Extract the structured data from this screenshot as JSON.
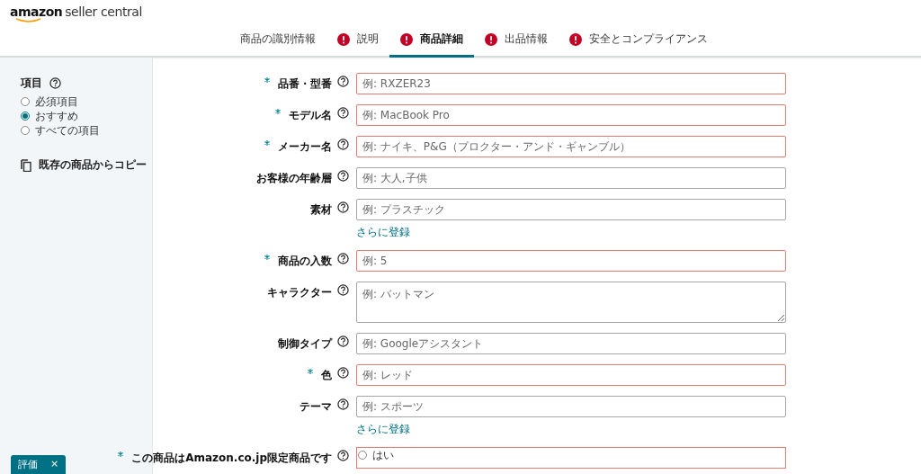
{
  "header": {
    "logo_word": "amazon",
    "logo_rest": "seller central"
  },
  "tabs": [
    {
      "label": "商品の識別情報",
      "error": false,
      "selected": false
    },
    {
      "label": "説明",
      "error": true,
      "selected": false
    },
    {
      "label": "商品詳細",
      "error": true,
      "selected": true
    },
    {
      "label": "出品情報",
      "error": true,
      "selected": false
    },
    {
      "label": "安全とコンプライアンス",
      "error": true,
      "selected": false
    }
  ],
  "sidebar": {
    "title": "項目",
    "options": [
      {
        "label": "必須項目",
        "selected": false
      },
      {
        "label": "おすすめ",
        "selected": true
      },
      {
        "label": "すべての項目",
        "selected": false
      }
    ],
    "copy_link": "既存の商品からコピー",
    "badge": "評価",
    "badge_close": "×"
  },
  "fields": [
    {
      "kind": "input",
      "label": "品番・型番",
      "required": true,
      "invalid": true,
      "placeholder": "例: RXZER23"
    },
    {
      "kind": "input",
      "label": "モデル名",
      "required": true,
      "invalid": true,
      "placeholder": "例: MacBook Pro"
    },
    {
      "kind": "input",
      "label": "メーカー名",
      "required": true,
      "invalid": true,
      "placeholder": "例: ナイキ、P&G（プロクター・アンド・ギャンブル）"
    },
    {
      "kind": "input",
      "label": "お客様の年齢層",
      "required": false,
      "invalid": false,
      "placeholder": "例: 大人,子供"
    },
    {
      "kind": "input",
      "label": "素材",
      "required": false,
      "invalid": false,
      "placeholder": "例: プラスチック",
      "more_link": "さらに登録"
    },
    {
      "kind": "input",
      "label": "商品の入数",
      "required": true,
      "invalid": true,
      "placeholder": "例: 5"
    },
    {
      "kind": "textarea",
      "label": "キャラクター",
      "required": false,
      "invalid": false,
      "placeholder": "例: バットマン"
    },
    {
      "kind": "input",
      "label": "制御タイプ",
      "required": false,
      "invalid": false,
      "placeholder": "例: Googleアシスタント"
    },
    {
      "kind": "input",
      "label": "色",
      "required": true,
      "invalid": true,
      "placeholder": "例: レッド"
    },
    {
      "kind": "input",
      "label": "テーマ",
      "required": false,
      "invalid": false,
      "placeholder": "例: スポーツ",
      "more_link": "さらに登録"
    },
    {
      "kind": "radio",
      "label": "この商品はAmazon.co.jp限定商品です",
      "required": true,
      "invalid": true,
      "options": [
        {
          "label": "はい",
          "selected": false
        }
      ]
    }
  ]
}
